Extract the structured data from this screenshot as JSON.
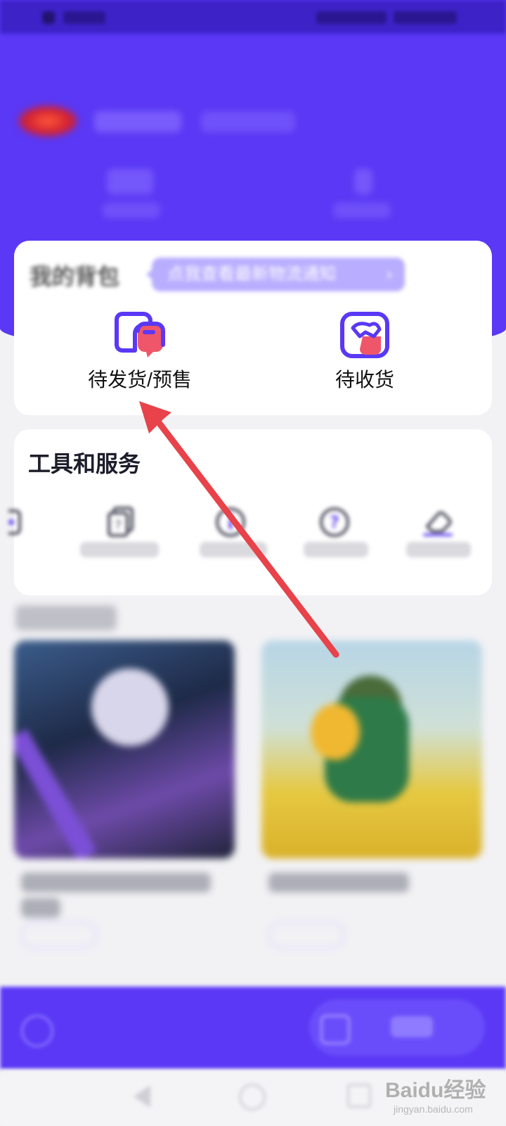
{
  "colors": {
    "brand_purple": "#5a38f5",
    "annotation_red": "#e8424a",
    "icon_pink": "#f0566a"
  },
  "bag": {
    "title": "我的背包",
    "notice": "点我查看最新物流通知",
    "items": [
      {
        "label": "待发货/预售",
        "icon": "pending-shipment-icon"
      },
      {
        "label": "待收货",
        "icon": "pending-receipt-icon"
      }
    ]
  },
  "tools": {
    "title": "工具和服务",
    "items": [
      {
        "label": "",
        "icon": "partial-tool-icon"
      },
      {
        "label": "",
        "icon": "help-cards-icon"
      },
      {
        "label": "",
        "icon": "info-icon"
      },
      {
        "label": "",
        "icon": "question-icon"
      },
      {
        "label": "",
        "icon": "eraser-icon"
      }
    ]
  },
  "watermark": {
    "brand": "Baidu经验",
    "url": "jingyan.baidu.com"
  }
}
